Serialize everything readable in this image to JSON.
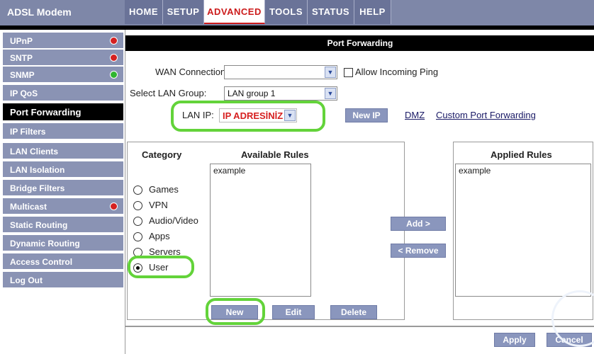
{
  "header": {
    "brand": "ADSL Modem",
    "tabs": [
      {
        "label": "HOME",
        "active": false
      },
      {
        "label": "SETUP",
        "active": false
      },
      {
        "label": "ADVANCED",
        "active": true
      },
      {
        "label": "TOOLS",
        "active": false
      },
      {
        "label": "STATUS",
        "active": false
      },
      {
        "label": "HELP",
        "active": false
      }
    ]
  },
  "sidebar": {
    "items": [
      {
        "label": "UPnP",
        "status": "red"
      },
      {
        "label": "SNTP",
        "status": "red"
      },
      {
        "label": "SNMP",
        "status": "green"
      },
      {
        "label": "IP QoS",
        "status": ""
      },
      {
        "label": "Port Forwarding",
        "status": "",
        "active": true
      },
      {
        "label": "IP Filters",
        "status": ""
      },
      {
        "label": "LAN Clients",
        "status": ""
      },
      {
        "label": "LAN Isolation",
        "status": ""
      },
      {
        "label": "Bridge Filters",
        "status": ""
      },
      {
        "label": "Multicast",
        "status": "red"
      },
      {
        "label": "Static Routing",
        "status": ""
      },
      {
        "label": "Dynamic Routing",
        "status": ""
      },
      {
        "label": "Access Control",
        "status": ""
      },
      {
        "label": "Log Out",
        "status": ""
      }
    ]
  },
  "main": {
    "title": "Port Forwarding",
    "wan_connection_label": "WAN Connection:",
    "wan_connection_value": "",
    "allow_ping_label": "Allow Incoming Ping",
    "select_lan_group_label": "Select LAN Group:",
    "lan_group_value": "LAN group 1",
    "lan_ip_label": "LAN IP:",
    "lan_ip_value": "IP ADRESİNİZ",
    "new_ip_button": "New IP",
    "dmz_link": "DMZ",
    "custom_pf_link": "Custom Port Forwarding",
    "category_title": "Category",
    "available_rules_title": "Available Rules",
    "applied_rules_title": "Applied Rules",
    "categories": [
      {
        "label": "Games",
        "checked": false
      },
      {
        "label": "VPN",
        "checked": false
      },
      {
        "label": "Audio/Video",
        "checked": false
      },
      {
        "label": "Apps",
        "checked": false
      },
      {
        "label": "Servers",
        "checked": false
      },
      {
        "label": "User",
        "checked": true
      }
    ],
    "available_rules": [
      "example"
    ],
    "applied_rules": [
      "example"
    ],
    "add_button": "Add >",
    "remove_button": "< Remove",
    "new_button": "New",
    "edit_button": "Edit",
    "delete_button": "Delete",
    "apply_button": "Apply",
    "cancel_button": "Cancel"
  },
  "colors": {
    "nav_bg": "#7e87a8",
    "sidebar_item": "#8a93b4",
    "button": "#8a96bd",
    "highlight": "#63d33a",
    "lan_ip_text": "#d61f1f"
  }
}
